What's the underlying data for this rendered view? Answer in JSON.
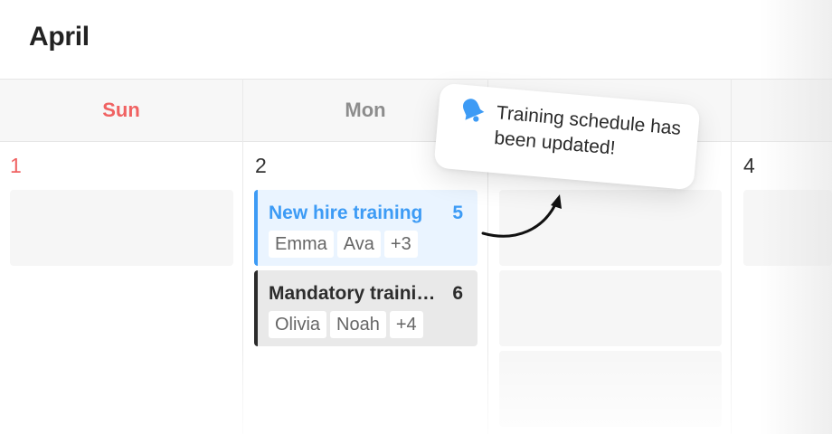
{
  "calendar": {
    "month": "April",
    "days": [
      {
        "name": "Sun",
        "date": "1"
      },
      {
        "name": "Mon",
        "date": "2"
      },
      {
        "name": "",
        "date": ""
      },
      {
        "name": "",
        "date": "4"
      }
    ],
    "events": [
      {
        "title": "New hire training",
        "count": "5",
        "attendees": [
          "Emma",
          "Ava"
        ],
        "more": "+3",
        "color": "#3d9bf5"
      },
      {
        "title": "Mandatory training",
        "count": "6",
        "attendees": [
          "Olivia",
          "Noah"
        ],
        "more": "+4",
        "color": "#2b2b2b"
      }
    ]
  },
  "notification": {
    "icon": "bell-icon",
    "message": "Training schedule has been updated!"
  },
  "colors": {
    "sunday": "#f06262",
    "accent": "#3d9bf5"
  }
}
